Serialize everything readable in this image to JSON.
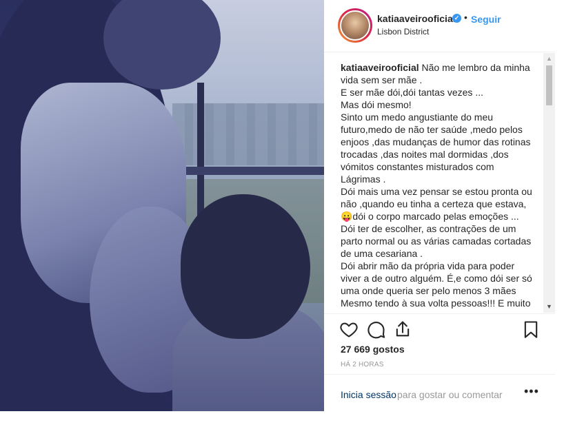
{
  "header": {
    "username": "katiaaveirooficial",
    "verified_badge": "✓",
    "separator": "•",
    "follow_label": "Seguir",
    "location": "Lisbon District"
  },
  "caption": {
    "username": "katiaaveirooficial",
    "lines": [
      "Não me lembro da minha vida sem ser mãe .",
      "E ser mãe dói,dói tantas vezes ...",
      "Mas dói mesmo!",
      "Sinto um medo angustiante do meu futuro,medo de não ter saúde ,medo pelos enjoos ,das mudanças de humor das rotinas trocadas ,das noites mal dormidas ,dos vómitos constantes misturados com Lágrimas .",
      "Dói mais uma vez pensar se estou pronta ou não ,quando eu tinha a certeza que estava,😛dói o corpo marcado pelas emoções ...",
      "Dói ter de escolher, as contrações de um parto normal ou as várias camadas cortadas de uma cesariana .",
      "Dói abrir mão da própria vida para poder viver a de outro alguém. É,e como dói ser só uma onde queria ser pelo menos 3 mães",
      "Mesmo tendo à sua volta pessoas!!! E muito"
    ]
  },
  "actions": {
    "icons": [
      "heart-icon",
      "comment-icon",
      "share-icon",
      "bookmark-icon"
    ]
  },
  "likes": "27 669 gostos",
  "time": "HÁ 2 HORAS",
  "comment_bar": {
    "login_link": "Inicia sessão",
    "login_rest": "para gostar ou comentar",
    "more_label": "•••"
  },
  "colors": {
    "accent": "#3897f0",
    "link": "#003569",
    "muted": "#999999",
    "text": "#262626"
  }
}
